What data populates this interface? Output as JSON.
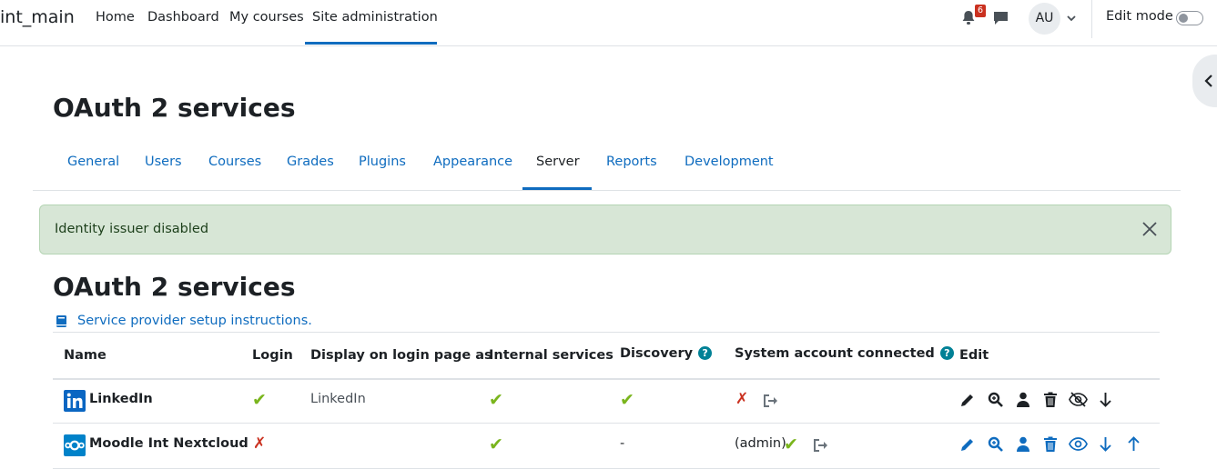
{
  "navbar": {
    "brand": "int_main",
    "links": [
      "Home",
      "Dashboard",
      "My courses",
      "Site administration"
    ],
    "notification_count": "6",
    "avatar_initials": "AU",
    "edit_mode_label": "Edit mode"
  },
  "page": {
    "title": "OAuth 2 services",
    "tabs": [
      "General",
      "Users",
      "Courses",
      "Grades",
      "Plugins",
      "Appearance",
      "Server",
      "Reports",
      "Development"
    ],
    "active_tab": "Server"
  },
  "alert": {
    "message": "Identity issuer disabled"
  },
  "section": {
    "title": "OAuth 2 services",
    "help_link": "Service provider setup instructions."
  },
  "table": {
    "headers": [
      "Name",
      "Login",
      "Display on login page as",
      "Internal services",
      "Discovery",
      "System account connected",
      "Edit"
    ],
    "rows": [
      {
        "name": "LinkedIn",
        "logo": "linkedin-logo",
        "login": "enabled",
        "display_as": "LinkedIn",
        "internal_services": "enabled",
        "discovery": "enabled",
        "system_account": "not-connected",
        "system_account_text": "",
        "edit_icons": [
          "edit-icon",
          "search-icon",
          "user-icon",
          "delete-icon",
          "hide-icon",
          "arrow-down-icon"
        ]
      },
      {
        "name": "Moodle Int Nextcloud",
        "logo": "nextcloud-logo",
        "login": "disabled",
        "display_as": "",
        "internal_services": "enabled",
        "discovery": "-",
        "system_account": "connected",
        "system_account_text": "(admin)",
        "edit_icons": [
          "edit-icon",
          "search-icon",
          "user-icon",
          "delete-icon",
          "show-icon",
          "arrow-down-icon",
          "arrow-up-icon"
        ]
      }
    ]
  },
  "colors": {
    "link": "#0f6cbf",
    "success_bg": "#d7e6d6",
    "check": "#7ab51d",
    "cross": "#ca3120",
    "help_icon": "#008196"
  }
}
